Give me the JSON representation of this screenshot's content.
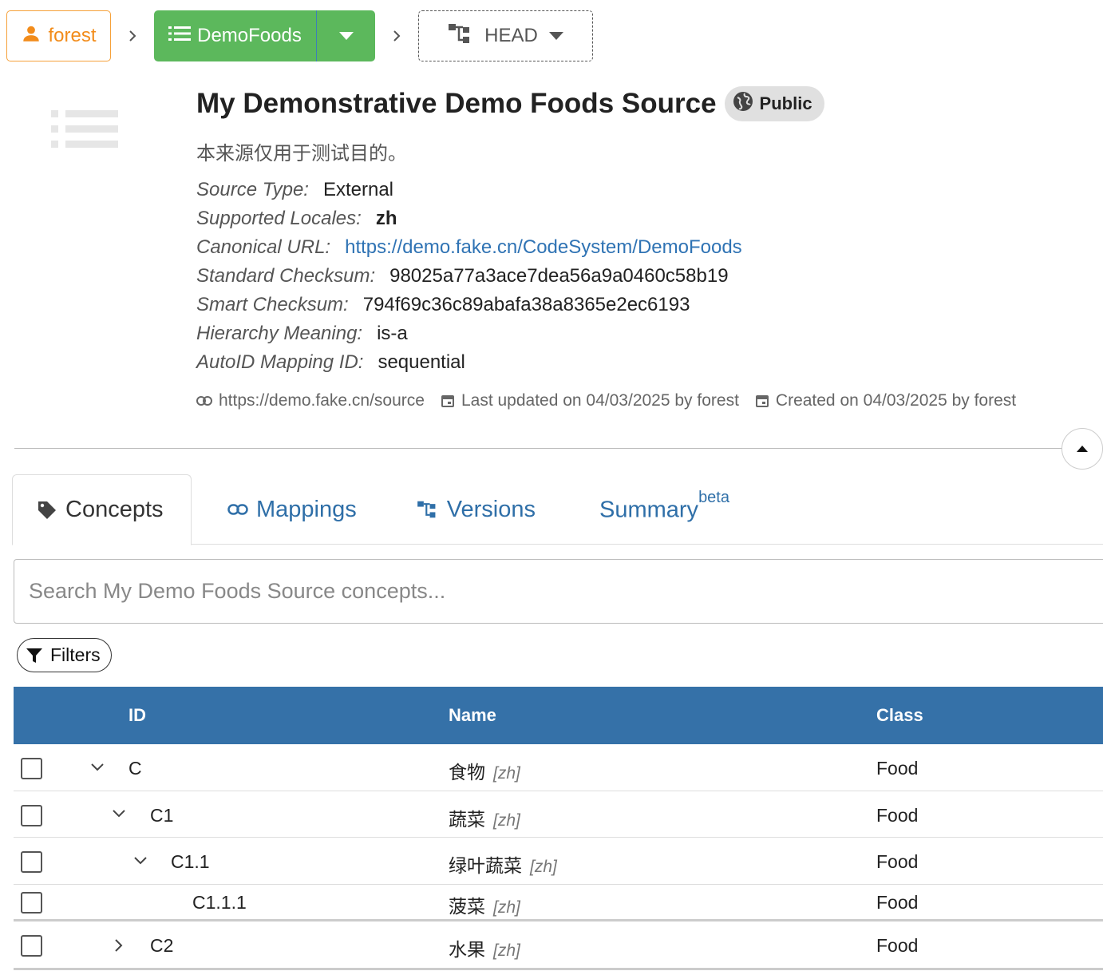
{
  "breadcrumb": {
    "owner": "forest",
    "repo": "DemoFoods",
    "version": "HEAD"
  },
  "header": {
    "title": "My Demonstrative Demo Foods Source",
    "visibility": "Public",
    "description": "本来源仅用于测试目的。",
    "properties": [
      {
        "key": "Source Type:",
        "value": "External"
      },
      {
        "key": "Supported Locales:",
        "value": "zh"
      },
      {
        "key": "Canonical URL:",
        "value": "https://demo.fake.cn/CodeSystem/DemoFoods"
      },
      {
        "key": "Standard Checksum:",
        "value": "98025a77a3ace7dea56a9a0460c58b19"
      },
      {
        "key": "Smart Checksum:",
        "value": "794f69c36c89abafa38a8365e2ec6193"
      },
      {
        "key": "Hierarchy Meaning:",
        "value": "is-a"
      },
      {
        "key": "AutoID Mapping ID:",
        "value": "sequential"
      }
    ],
    "meta": {
      "website": "https://demo.fake.cn/source",
      "updated": "Last updated on 04/03/2025 by forest",
      "created": "Created on 04/03/2025 by forest"
    }
  },
  "tabs": [
    {
      "label": "Concepts",
      "icon": "tag-icon",
      "active": true
    },
    {
      "label": "Mappings",
      "icon": "link-icon"
    },
    {
      "label": "Versions",
      "icon": "versions-icon"
    },
    {
      "label": "Summary",
      "sup": "beta",
      "icon": ""
    }
  ],
  "search": {
    "placeholder": "Search My Demo Foods Source concepts..."
  },
  "filters_label": "Filters",
  "table": {
    "columns": [
      "ID",
      "Name",
      "Class"
    ],
    "rows": [
      {
        "id": "C",
        "name": "食物",
        "locale": "[zh]",
        "class": "Food",
        "level": 0,
        "expander": "expanded"
      },
      {
        "id": "C1",
        "name": "蔬菜",
        "locale": "[zh]",
        "class": "Food",
        "level": 1,
        "expander": "expanded"
      },
      {
        "id": "C1.1",
        "name": "绿叶蔬菜",
        "locale": "[zh]",
        "class": "Food",
        "level": 2,
        "expander": "expanded"
      },
      {
        "id": "C1.1.1",
        "name": "菠菜",
        "locale": "[zh]",
        "class": "Food",
        "level": 3,
        "expander": "none"
      },
      {
        "id": "C2",
        "name": "水果",
        "locale": "[zh]",
        "class": "Food",
        "level": 1,
        "expander": "collapsed"
      }
    ]
  },
  "colors": {
    "owner_accent": "#f28c1b",
    "repo_green": "#5cb85c",
    "link_blue": "#2f73b4",
    "table_header": "#3571a8"
  }
}
